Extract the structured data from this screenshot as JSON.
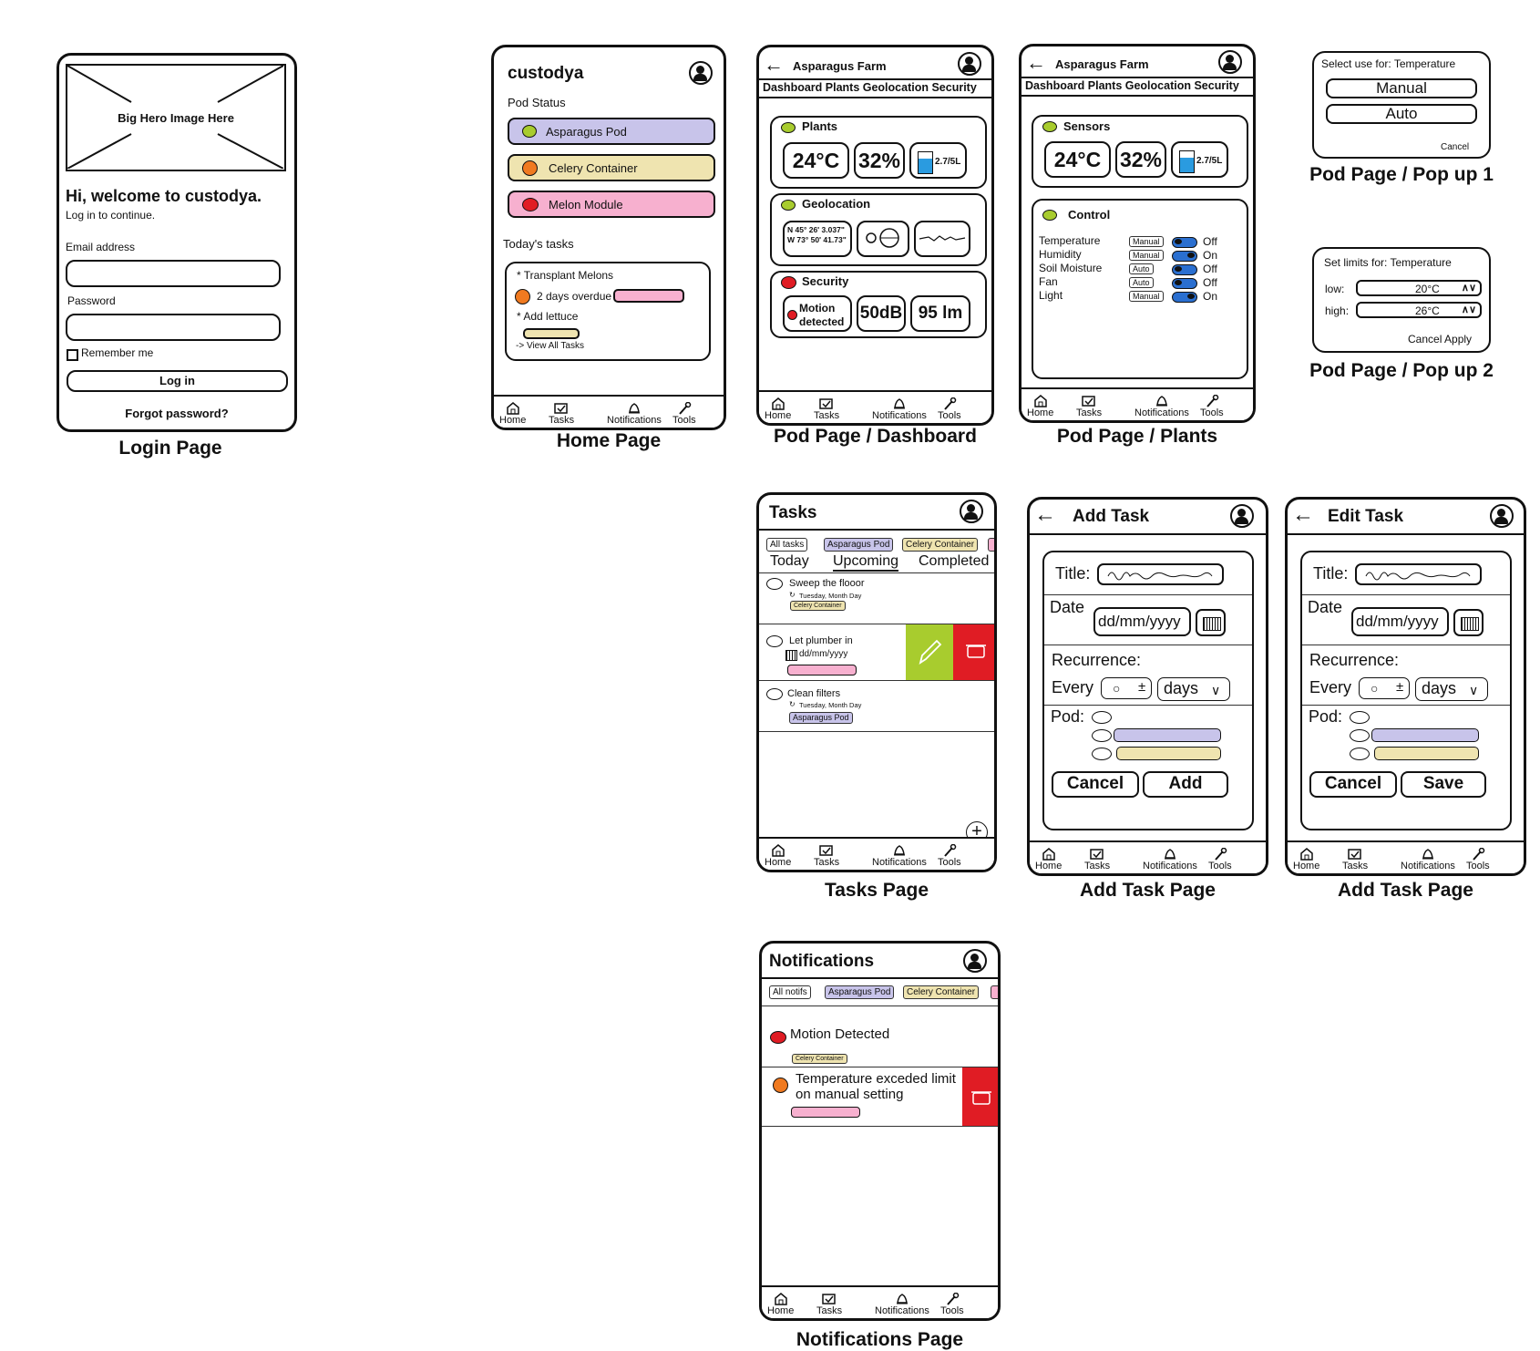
{
  "colors": {
    "asparagus": "#c8c4ea",
    "celery": "#efe4b0",
    "melon": "#f7b0cf",
    "green": "#a8cc2e",
    "red": "#e01c24",
    "orange": "#f07a20"
  },
  "nav": {
    "home": "Home",
    "tasks": "Tasks",
    "notifications": "Notifications",
    "tools": "Tools"
  },
  "login": {
    "caption": "Login Page",
    "hero": "Big Hero Image Here",
    "welcome": "Hi, welcome to custodya.",
    "sub": "Log in to continue.",
    "email_label": "Email address",
    "password_label": "Password",
    "remember": "Remember me",
    "login_btn": "Log in",
    "forgot": "Forgot password?"
  },
  "home": {
    "caption": "Home Page",
    "title": "custodya",
    "pod_status": "Pod Status",
    "pods": [
      "Asparagus Pod",
      "Celery Container",
      "Melon Module"
    ],
    "todays_tasks": "Today's tasks",
    "task1": "* Transplant Melons",
    "overdue": "2 days overdue",
    "task2": "* Add lettuce",
    "view_all": "-> View All Tasks"
  },
  "dash": {
    "caption": "Pod Page / Dashboard",
    "title": "Asparagus Farm",
    "tabs": "Dashboard Plants Geolocation Security",
    "plants": "Plants",
    "temp": "24°C",
    "hum": "32%",
    "water": "2.7/5L",
    "geo": "Geolocation",
    "coord1": "N 45° 26' 3.037\"",
    "coord2": "W 73° 50' 41.73\"",
    "security": "Security",
    "motion1": "Motion",
    "motion2": "detected",
    "db": "50dB",
    "lm": "95 lm"
  },
  "plants": {
    "caption": "Pod Page / Plants",
    "title": "Asparagus Farm",
    "tabs": "Dashboard Plants Geolocation Security",
    "sensors": "Sensors",
    "temp": "24°C",
    "hum": "32%",
    "water": "2.7/5L",
    "control": "Control",
    "rows": [
      {
        "name": "Temperature",
        "mode": "Manual",
        "state": "Off"
      },
      {
        "name": "Humidity",
        "mode": "Manual",
        "state": "On"
      },
      {
        "name": "Soil Moisture",
        "mode": "Auto",
        "state": "Off"
      },
      {
        "name": "Fan",
        "mode": "Auto",
        "state": "Off"
      },
      {
        "name": "Light",
        "mode": "Manual",
        "state": "On"
      }
    ]
  },
  "popup1": {
    "caption": "Pod Page / Pop up 1",
    "title": "Select use for: Temperature",
    "manual": "Manual",
    "auto": "Auto",
    "cancel": "Cancel"
  },
  "popup2": {
    "caption": "Pod Page / Pop up 2",
    "title": "Set limits for: Temperature",
    "low": "low:",
    "high": "high:",
    "low_val": "20°C",
    "high_val": "26°C",
    "actions": "Cancel Apply"
  },
  "tasks": {
    "caption": "Tasks Page",
    "title": "Tasks",
    "filters": [
      "All tasks",
      "Asparagus Pod",
      "Celery Container"
    ],
    "tabs": [
      "Today",
      "Upcoming",
      "Completed"
    ],
    "items": [
      {
        "title": "Sweep the flooor",
        "date": "Tuesday, Month Day",
        "tag": "Celery Container"
      },
      {
        "title": "Let plumber in",
        "date": "dd/mm/yyyy",
        "tag": ""
      },
      {
        "title": "Clean filters",
        "date": "Tuesday, Month Day",
        "tag": "Asparagus Pod"
      }
    ]
  },
  "addtask": {
    "caption": "Add Task Page",
    "title": "Add Task",
    "title_label": "Title:",
    "date_label": "Date",
    "date_ph": "dd/mm/yyyy",
    "recurrence": "Recurrence:",
    "every": "Every",
    "unit": "days",
    "pod": "Pod:",
    "cancel": "Cancel",
    "add": "Add"
  },
  "edittask": {
    "caption": "Add Task Page",
    "title": "Edit Task",
    "title_label": "Title:",
    "date_label": "Date",
    "date_ph": "dd/mm/yyyy",
    "recurrence": "Recurrence:",
    "every": "Every",
    "unit": "days",
    "pod": "Pod:",
    "cancel": "Cancel",
    "save": "Save"
  },
  "notifs": {
    "caption": "Notifications Page",
    "title": "Notifications",
    "filters": [
      "All notifs",
      "Asparagus Pod",
      "Celery Container"
    ],
    "n1": "Motion Detected",
    "n1_tag": "Celery Container",
    "n2a": "Temperature exceded limit",
    "n2b": "on manual setting"
  }
}
